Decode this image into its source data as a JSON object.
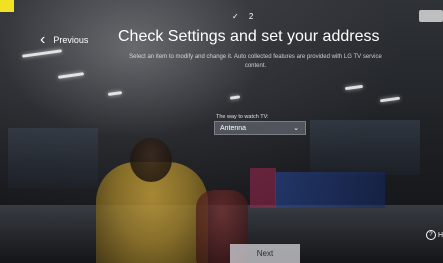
{
  "progress": {
    "step_label": "✓ 2"
  },
  "nav": {
    "previous_label": "Previous"
  },
  "header": {
    "title": "Check Settings and set your address",
    "subtitle": "Select an item to modify and change it. Auto collected features are provided with LG TV service content."
  },
  "tv_source": {
    "question": "The way to watch TV:",
    "selected_value": "Antenna"
  },
  "footer": {
    "next_label": "Next",
    "help_label": "H"
  }
}
